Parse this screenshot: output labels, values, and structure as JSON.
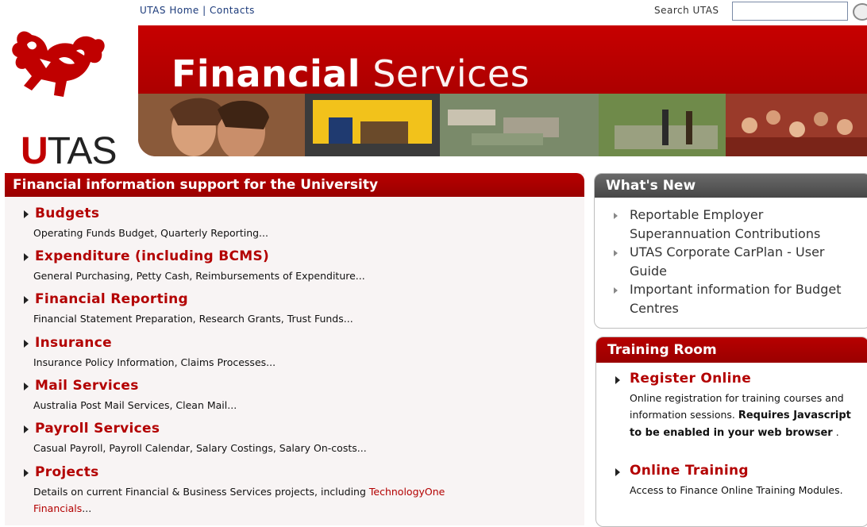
{
  "top_links": {
    "home": "UTAS Home",
    "separator": "|",
    "contacts": "Contacts"
  },
  "search": {
    "label": "Search UTAS",
    "placeholder": ""
  },
  "logo": {
    "initial": "U",
    "rest": "TAS"
  },
  "banner": {
    "title_bold": "Financial",
    "title_light": "Services"
  },
  "main_panel": {
    "heading": "Financial information support for the University",
    "items": [
      {
        "title": "Budgets",
        "desc": "Operating Funds Budget, Quarterly Reporting..."
      },
      {
        "title": "Expenditure (including BCMS)",
        "desc": "General Purchasing, Petty Cash, Reimbursements of Expenditure..."
      },
      {
        "title": "Financial Reporting",
        "desc": "Financial Statement Preparation, Research Grants, Trust Funds..."
      },
      {
        "title": "Insurance",
        "desc": "Insurance Policy Information, Claims Processes..."
      },
      {
        "title": "Mail Services",
        "desc": "Australia Post Mail Services, Clean Mail..."
      },
      {
        "title": "Payroll Services",
        "desc": "Casual Payroll, Payroll Calendar, Salary Costings, Salary On-costs..."
      },
      {
        "title": "Projects",
        "desc": "Details on current Financial & Business Services projects, including ",
        "link": "TechnologyOne",
        "link2": "Financials",
        "desc_end": "..."
      }
    ]
  },
  "whats_new": {
    "heading": "What's New",
    "items": [
      "Reportable Employer Superannuation Contributions",
      "UTAS Corporate CarPlan - User Guide",
      "Important information for Budget Centres"
    ]
  },
  "training_room": {
    "heading": "Training Room",
    "items": [
      {
        "title": "Register Online",
        "desc": "Online registration for training courses and information sessions.",
        "bold": "Requires Javascript to be enabled in your web browser",
        "end": "."
      },
      {
        "title": "Online Training",
        "desc": "Access to Finance Online Training Modules."
      }
    ]
  },
  "colors": {
    "brand_red": "#b30000",
    "header_gray": "#555555",
    "link_blue": "#1b3a7a"
  }
}
